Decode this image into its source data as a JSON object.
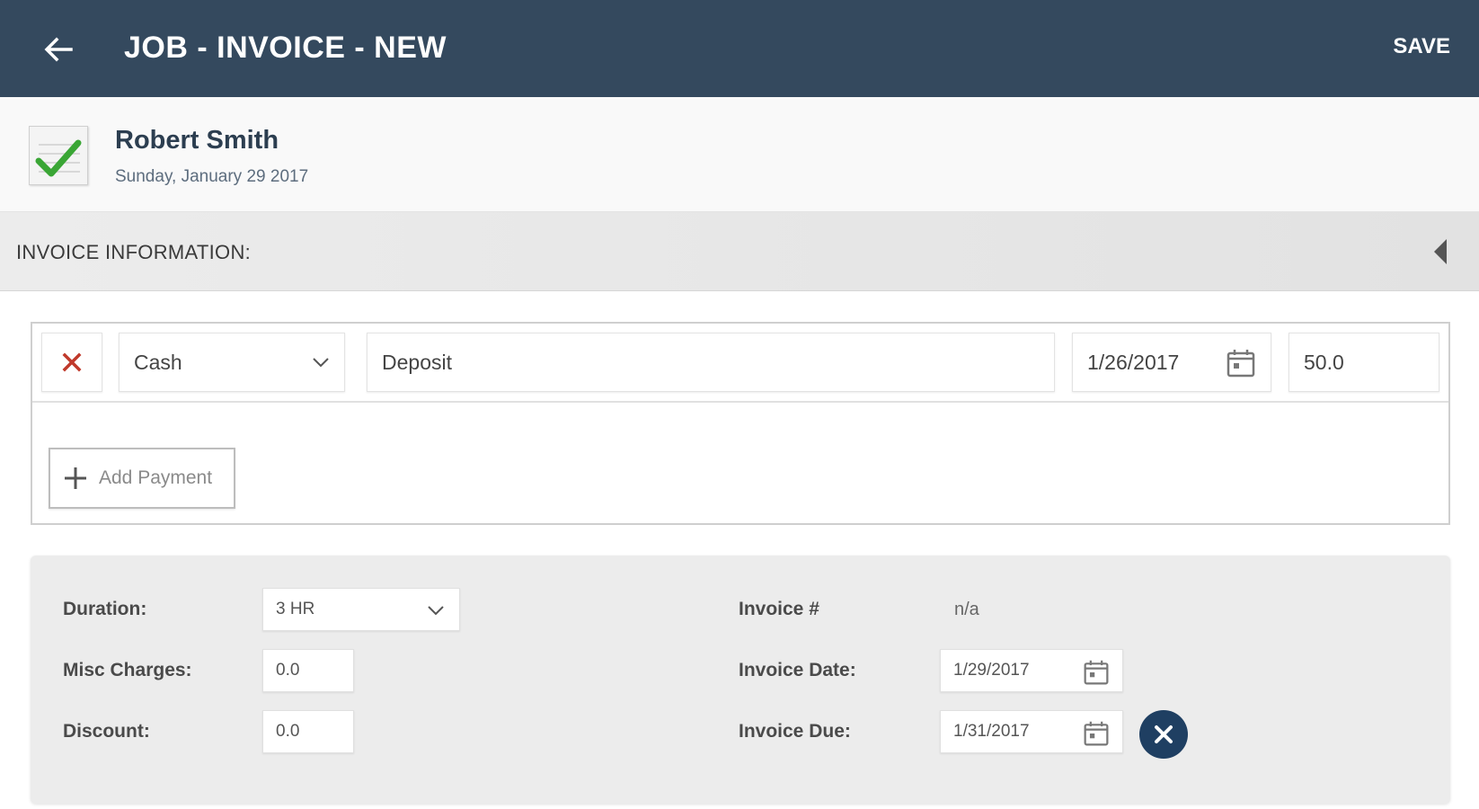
{
  "appbar": {
    "title": "JOB - INVOICE - NEW",
    "save_label": "SAVE",
    "bg_color": "#34495e"
  },
  "customer": {
    "name": "Robert Smith",
    "date": "Sunday, January 29 2017"
  },
  "section": {
    "title": "INVOICE INFORMATION:"
  },
  "payments": [
    {
      "method": "Cash",
      "description": "Deposit",
      "date": "1/26/2017",
      "amount": "50.0"
    }
  ],
  "add_payment_label": "Add Payment",
  "details": {
    "duration_label": "Duration:",
    "duration_value": "3 HR",
    "misc_label": "Misc Charges:",
    "misc_value": "0.0",
    "discount_label": "Discount:",
    "discount_value": "0.0",
    "invoice_num_label": "Invoice #",
    "invoice_num_value": "n/a",
    "invoice_date_label": "Invoice Date:",
    "invoice_date_value": "1/29/2017",
    "invoice_due_label": "Invoice Due:",
    "invoice_due_value": "1/31/2017"
  },
  "icons": {
    "back": "arrow-left-icon",
    "check": "checkmark-icon",
    "collapse": "triangle-left-icon",
    "delete": "x-icon",
    "dropdown": "chevron-down-icon",
    "calendar": "calendar-icon",
    "plus": "plus-icon",
    "clear": "close-circle-icon"
  },
  "colors": {
    "accent_dark": "#1f3f62",
    "delete_red": "#c0392b",
    "check_green": "#3aa635"
  }
}
